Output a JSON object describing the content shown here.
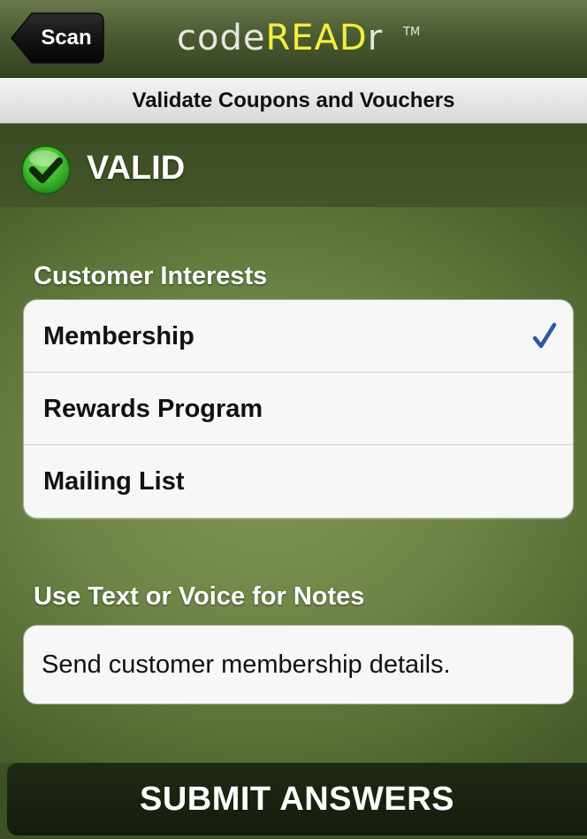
{
  "navbar": {
    "back_label": "Scan",
    "logo_code": "code",
    "logo_read": "READ",
    "logo_r": "r",
    "logo_tm": "TM"
  },
  "subheader": {
    "title": "Validate Coupons and Vouchers"
  },
  "status": {
    "text": "VALID",
    "icon": "green-check-circle-icon"
  },
  "interests": {
    "label": "Customer Interests",
    "items": [
      {
        "label": "Membership",
        "checked": true
      },
      {
        "label": "Rewards Program",
        "checked": false
      },
      {
        "label": "Mailing List",
        "checked": false
      }
    ]
  },
  "notes": {
    "label": "Use Text or Voice for Notes",
    "value": "Send customer membership details."
  },
  "submit": {
    "label": "SUBMIT ANSWERS"
  },
  "colors": {
    "accent_check": "#2c5aa0",
    "logo_yellow": "#f3ee3f",
    "valid_green": "#3db52c"
  }
}
